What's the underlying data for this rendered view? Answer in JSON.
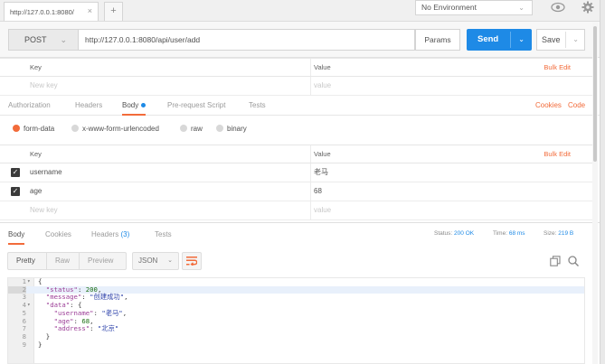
{
  "tabs": {
    "request_tab_label": "http://127.0.0.1:8080/",
    "close_glyph": "×",
    "add_glyph": "+"
  },
  "environment": {
    "selected": "No Environment"
  },
  "request": {
    "method": "POST",
    "url": "http://127.0.0.1:8080/api/user/add",
    "params_label": "Params",
    "send_label": "Send",
    "save_label": "Save"
  },
  "params_table": {
    "key_header": "Key",
    "value_header": "Value",
    "bulk_edit": "Bulk Edit",
    "new_key_placeholder": "New key",
    "value_placeholder": "value"
  },
  "request_tabs": {
    "authorization": "Authorization",
    "headers": "Headers",
    "body": "Body",
    "pre_request": "Pre-request Script",
    "tests": "Tests",
    "cookies": "Cookies",
    "code": "Code"
  },
  "body_types": {
    "form_data": "form-data",
    "urlencoded": "x-www-form-urlencoded",
    "raw": "raw",
    "binary": "binary"
  },
  "body_table": {
    "key_header": "Key",
    "value_header": "Value",
    "bulk_edit": "Bulk Edit",
    "rows": [
      {
        "key": "username",
        "value": "老马"
      },
      {
        "key": "age",
        "value": "68"
      }
    ],
    "new_key_placeholder": "New key",
    "value_placeholder": "value"
  },
  "response_tabs": {
    "body": "Body",
    "cookies": "Cookies",
    "headers": "Headers",
    "headers_count": "(3)",
    "tests": "Tests"
  },
  "response_meta": {
    "status_label": "Status:",
    "status_value": "200 OK",
    "time_label": "Time:",
    "time_value": "68 ms",
    "size_label": "Size:",
    "size_value": "219 B"
  },
  "response_view": {
    "pretty": "Pretty",
    "raw": "Raw",
    "preview": "Preview",
    "format": "JSON"
  },
  "response_body": {
    "lines": [
      "{",
      "  \"status\": 200,",
      "  \"message\": \"创建成功\",",
      "  \"data\": {",
      "    \"username\": \"老马\",",
      "    \"age\": 68,",
      "    \"address\": \"北京\"",
      "  }",
      "}"
    ]
  },
  "colors": {
    "accent": "#f26b3a",
    "send_blue": "#1e8ae6"
  }
}
